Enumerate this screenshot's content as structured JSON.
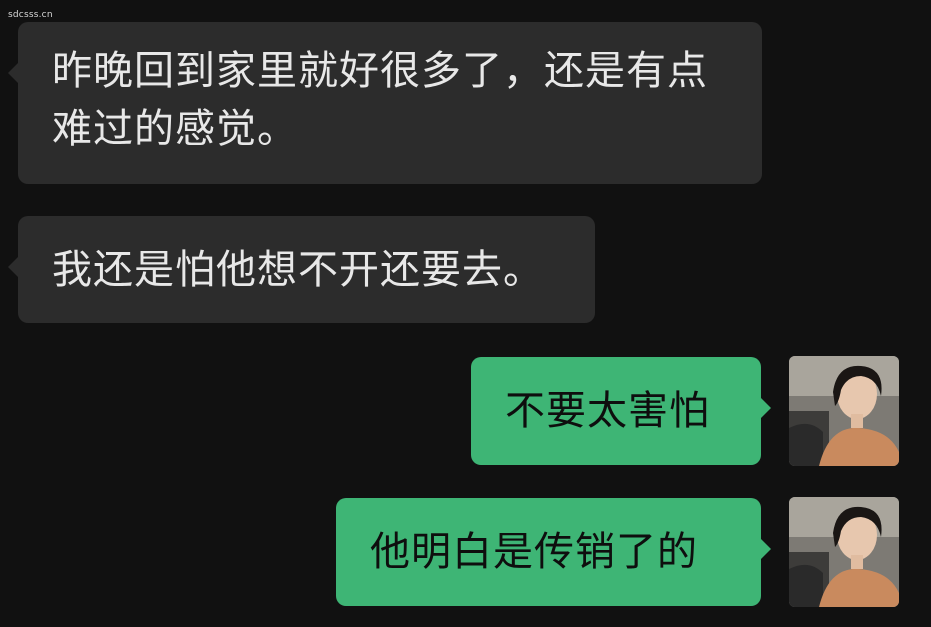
{
  "watermark": "sdcsss.cn",
  "messages": [
    {
      "side": "incoming",
      "text": "昨晚回到家里就好很多了，还是有点难过的感觉。"
    },
    {
      "side": "incoming",
      "text": "我还是怕他想不开还要去。"
    },
    {
      "side": "outgoing",
      "text": "不要太害怕"
    },
    {
      "side": "outgoing",
      "text": "他明白是传销了的"
    }
  ],
  "colors": {
    "background": "#111111",
    "incoming_bubble": "#2c2c2c",
    "outgoing_bubble": "#3eb575"
  }
}
